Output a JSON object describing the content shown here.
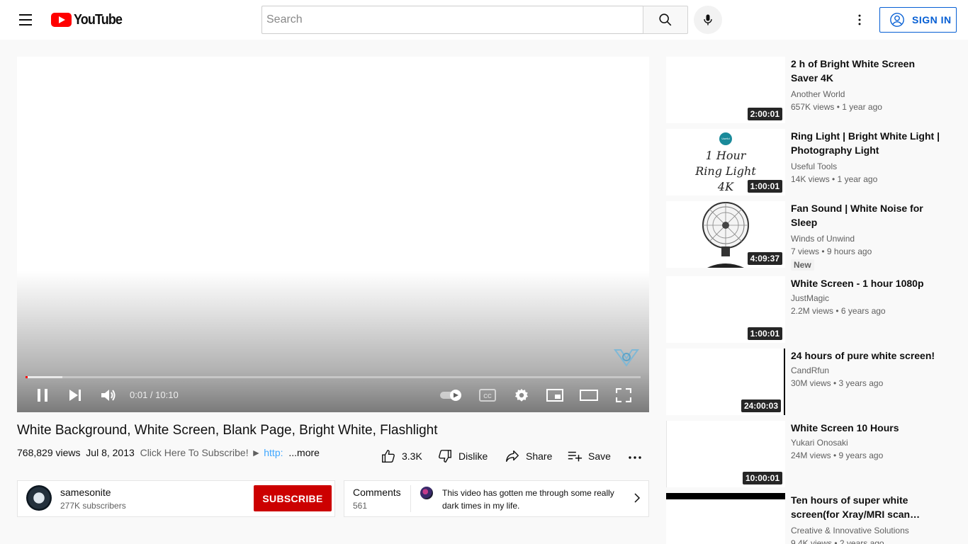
{
  "header": {
    "logo_text": "YouTube",
    "search_placeholder": "Search",
    "signin_label": "SIGN IN"
  },
  "player": {
    "time_current": "0:01",
    "time_total": "10:10",
    "time_display": "0:01 / 10:10",
    "progress_played_percent": 0.3,
    "progress_buffered_percent": 6
  },
  "video": {
    "title": "White Background, White Screen, Blank Page, Bright White, Flashlight",
    "views": "768,829 views",
    "date": "Jul 8, 2013",
    "description_snippet": "Click Here To Subscribe! ►",
    "description_link": "http:",
    "more_label": "...more",
    "likes": "3.3K",
    "dislike_label": "Dislike",
    "share_label": "Share",
    "save_label": "Save"
  },
  "channel": {
    "name": "samesonite",
    "subscribers": "277K subscribers",
    "subscribe_label": "SUBSCRIBE"
  },
  "comments": {
    "label": "Comments",
    "count": "561",
    "top_comment": "This video has gotten me through some really dark times in my life."
  },
  "recommendations": [
    {
      "title": "2 h of Bright White Screen Saver 4K",
      "channel": "Another World",
      "stats": "657K views • 1 year ago",
      "duration": "2:00:01"
    },
    {
      "title": "Ring Light | Bright White Light | Photography Light",
      "channel": "Useful Tools",
      "stats": "14K views • 1 year ago",
      "duration": "1:00:01",
      "thumb_lines": [
        "1 Hour",
        "Ring Light",
        "4K"
      ],
      "thumb_logo": "Useful Tools"
    },
    {
      "title": "Fan Sound | White Noise for Sleep",
      "channel": "Winds of Unwind",
      "stats": "7 views • 9 hours ago",
      "duration": "4:09:37",
      "badge": "New"
    },
    {
      "title": "White Screen - 1 hour 1080p",
      "channel": "JustMagic",
      "stats": "2.2M views • 6 years ago",
      "duration": "1:00:01"
    },
    {
      "title": "24 hours of pure white screen!",
      "channel": "CandRfun",
      "stats": "30M views • 3 years ago",
      "duration": "24:00:03"
    },
    {
      "title": "White Screen 10 Hours",
      "channel": "Yukari Onosaki",
      "stats": "24M views • 9 years ago",
      "duration": "10:00:01"
    },
    {
      "title": "Ten hours of super white screen(for Xray/MRI scan…",
      "channel": "Creative & Innovative Solutions",
      "stats": "9.4K views • 2 years ago",
      "duration": ""
    }
  ]
}
